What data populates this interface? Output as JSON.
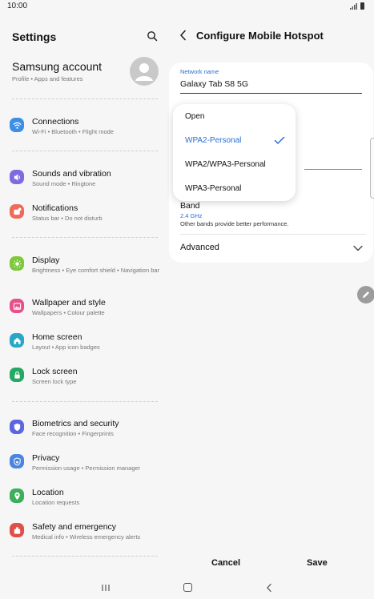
{
  "status": {
    "time": "10:00"
  },
  "left": {
    "title": "Settings",
    "account": {
      "name": "Samsung account",
      "sub": "Profile  •  Apps and features"
    },
    "items": [
      {
        "title": "Connections",
        "sub": "Wi-Fi  •  Bluetooth  •  Flight mode",
        "icon": "wifi-icon",
        "color": "#3d8fe6"
      },
      {
        "title": "Sounds and vibration",
        "sub": "Sound mode  •  Ringtone",
        "icon": "speaker-icon",
        "color": "#7e6be0"
      },
      {
        "title": "Notifications",
        "sub": "Status bar  •  Do not disturb",
        "icon": "notification-icon",
        "color": "#ef6a5a"
      },
      {
        "title": "Display",
        "sub": "Brightness  •  Eye comfort shield  •  Navigation bar",
        "icon": "sun-icon",
        "color": "#7dc83c"
      },
      {
        "title": "Wallpaper and style",
        "sub": "Wallpapers  •  Colour palette",
        "icon": "image-icon",
        "color": "#e9508a"
      },
      {
        "title": "Home screen",
        "sub": "Layout  •  App icon badges",
        "icon": "home-icon",
        "color": "#2aa7c7"
      },
      {
        "title": "Lock screen",
        "sub": "Screen lock type",
        "icon": "lock-icon",
        "color": "#23a866"
      },
      {
        "title": "Biometrics and security",
        "sub": "Face recognition  •  Fingerprints",
        "icon": "shield-icon",
        "color": "#5c66e0"
      },
      {
        "title": "Privacy",
        "sub": "Permission usage  •  Permission manager",
        "icon": "privacy-icon",
        "color": "#4a86e0"
      },
      {
        "title": "Location",
        "sub": "Location requests",
        "icon": "location-icon",
        "color": "#3cae5c"
      },
      {
        "title": "Safety and emergency",
        "sub": "Medical info  •  Wireless emergency alerts",
        "icon": "emergency-icon",
        "color": "#e0504a"
      }
    ]
  },
  "right": {
    "title": "Configure Mobile Hotspot",
    "network_name_label": "Network name",
    "network_name_value": "Galaxy Tab S8 5G",
    "security_options": [
      "Open",
      "WPA2-Personal",
      "WPA2/WPA3-Personal",
      "WPA3-Personal"
    ],
    "selected_option": "WPA2-Personal",
    "band": {
      "title": "Band",
      "value": "2.4 GHz",
      "note": "Other bands provide better performance."
    },
    "advanced": "Advanced",
    "cancel": "Cancel",
    "save": "Save"
  },
  "colors": {
    "accent": "#2a6fd1",
    "background": "#f6f6f6",
    "card": "#ffffff"
  }
}
